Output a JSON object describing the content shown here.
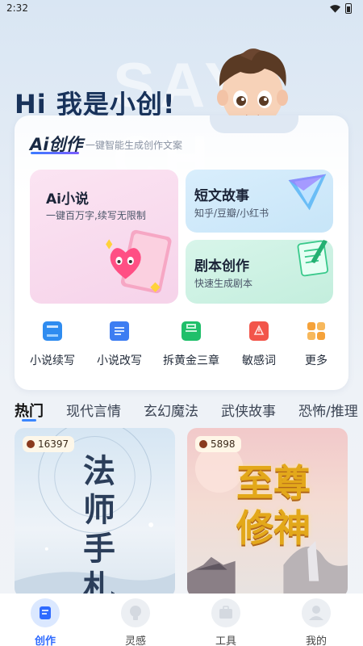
{
  "status": {
    "time": "2:32"
  },
  "watermark": "SAY CH",
  "hero": {
    "title": "Hi 我是小创!"
  },
  "card": {
    "logo": "Ai创作",
    "subtitle": "一键智能生成创作文案",
    "tiles": {
      "novel": {
        "title": "Ai小说",
        "desc": "一键百万字,续写无限制"
      },
      "story": {
        "title": "短文故事",
        "desc": "知乎/豆瓣/小红书"
      },
      "script": {
        "title": "剧本创作",
        "desc": "快速生成剧本"
      }
    },
    "tools": [
      {
        "label": "小说续写",
        "icon": "book-blue-icon",
        "color": "#2f8cf0"
      },
      {
        "label": "小说改写",
        "icon": "document-blue-icon",
        "color": "#3d7df2"
      },
      {
        "label": "拆黄金三章",
        "icon": "briefcase-green-icon",
        "color": "#1fbf6a"
      },
      {
        "label": "敏感词",
        "icon": "warning-book-red-icon",
        "color": "#f2554a"
      },
      {
        "label": "更多",
        "icon": "grid-orange-icon",
        "color": "#f5a23a"
      }
    ]
  },
  "categories": {
    "items": [
      "热门",
      "现代言情",
      "玄幻魔法",
      "武侠故事",
      "恐怖/推理"
    ],
    "active": "热门"
  },
  "books": [
    {
      "heat": "16397",
      "title": "法师手札"
    },
    {
      "heat": "5898",
      "title": "至尊修神"
    }
  ],
  "nav": [
    {
      "label": "创作",
      "icon": "edit-icon",
      "active": true
    },
    {
      "label": "灵感",
      "icon": "lightbulb-icon",
      "active": false
    },
    {
      "label": "工具",
      "icon": "toolbox-icon",
      "active": false
    },
    {
      "label": "我的",
      "icon": "user-icon",
      "active": false
    }
  ],
  "colors": {
    "accent": "#2f6bff",
    "heroText": "#18325a",
    "gold": "#e3a81a"
  }
}
